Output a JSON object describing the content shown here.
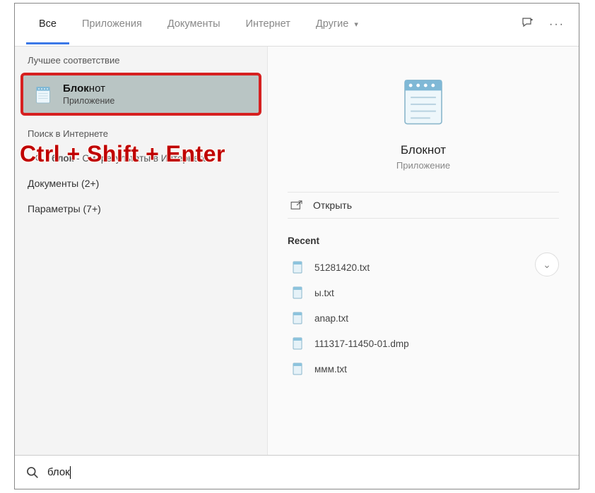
{
  "tabs": {
    "all": "Все",
    "apps": "Приложения",
    "docs": "Документы",
    "web": "Интернет",
    "more": "Другие"
  },
  "left": {
    "best_header": "Лучшее соответствие",
    "best_match": {
      "title_bold": "Блок",
      "title_rest": "нот",
      "subtitle": "Приложение"
    },
    "web_header": "Поиск в Интернете",
    "web_item_prefix": "блок",
    "web_item_rest": " - См. результаты в Интернете",
    "docs_item": "Документы (2+)",
    "settings_item": "Параметры (7+)"
  },
  "preview": {
    "title": "Блокнот",
    "subtitle": "Приложение",
    "open": "Открыть",
    "recent_header": "Recent",
    "recent": [
      "51281420.txt",
      "ы.txt",
      "anap.txt",
      "111317-11450-01.dmp",
      "ммм.txt"
    ]
  },
  "search": {
    "query": "блок"
  },
  "overlay": "Ctrl + Shift + Enter"
}
